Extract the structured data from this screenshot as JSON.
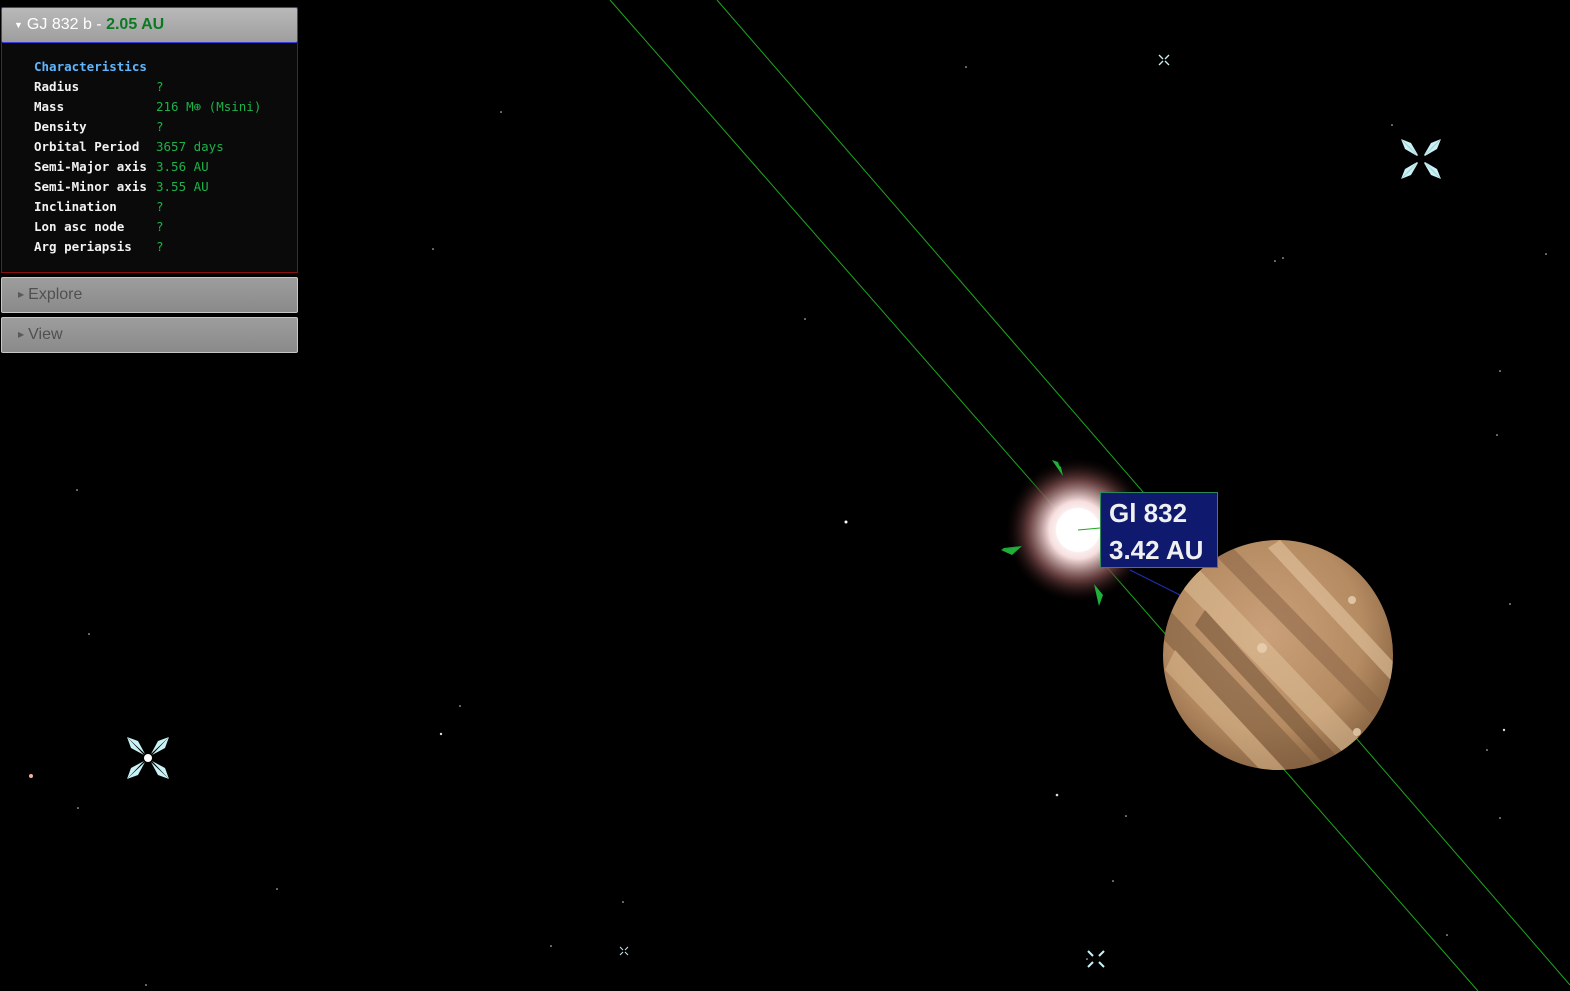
{
  "panel": {
    "planet_name": "GJ 832 b - ",
    "planet_distance": "2.05 AU",
    "section_title": "Characteristics",
    "rows": [
      {
        "key": "Radius",
        "value": "?"
      },
      {
        "key": "Mass",
        "value": "216 M⊕ (Msini)"
      },
      {
        "key": "Density",
        "value": "?"
      },
      {
        "key": "Orbital Period",
        "value": "3657 days"
      },
      {
        "key": "Semi-Major axis",
        "value": "3.56 AU"
      },
      {
        "key": "Semi-Minor axis",
        "value": "3.55 AU"
      },
      {
        "key": "Inclination",
        "value": "?"
      },
      {
        "key": "Lon asc node",
        "value": "?"
      },
      {
        "key": "Arg periapsis",
        "value": "?"
      }
    ],
    "explore_label": "Explore",
    "view_label": "View"
  },
  "star_label": {
    "name": "Gl 832",
    "distance": "3.42 AU"
  },
  "colors": {
    "background": "#000000",
    "orbit_line": "#1fa61f",
    "label_bg": "#0f1a6e",
    "value_text": "#1bb24a",
    "section_title": "#5fb6ff"
  },
  "icons": [
    "planet-jupiter-icon",
    "star-glow-icon",
    "star-marker-icon",
    "triangle-down-icon",
    "triangle-right-icon"
  ]
}
